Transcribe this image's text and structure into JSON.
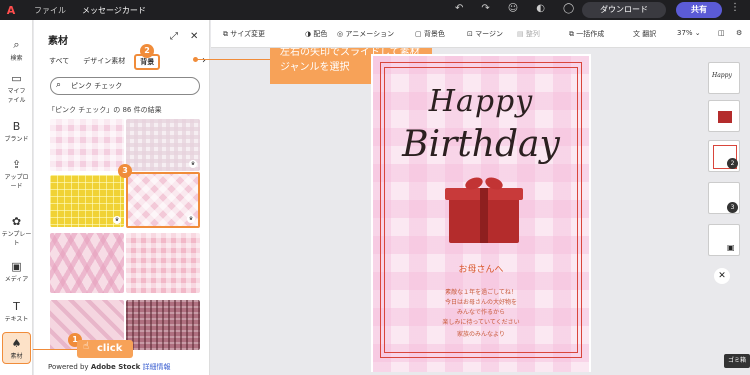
{
  "topbar": {
    "file_menu": "ファイル",
    "doc_title": "メッセージカード",
    "download": "ダウンロード",
    "share": "共有"
  },
  "leftnav": {
    "items": [
      {
        "label": "検索",
        "icon": "search-icon"
      },
      {
        "label": "マイファイル",
        "icon": "folder-icon"
      },
      {
        "label": "ブランド",
        "icon": "brand-icon"
      },
      {
        "label": "アップロード",
        "icon": "upload-icon"
      },
      {
        "label": "テンプレート",
        "icon": "template-icon"
      },
      {
        "label": "メディア",
        "icon": "media-icon"
      },
      {
        "label": "テキスト",
        "icon": "text-icon"
      },
      {
        "label": "素材",
        "icon": "assets-icon"
      }
    ]
  },
  "panel": {
    "title": "素材",
    "tabs": [
      "すべて",
      "デザイン素材",
      "背景"
    ],
    "active_tab": "背景",
    "search_value": "ピンク チェック",
    "results": "「ピンク チェック」の 86 件の結果",
    "footer_prefix": "Powered by",
    "footer_brand": "Adobe Stock",
    "footer_link": "詳細情報"
  },
  "annotations": {
    "step1": "1",
    "step2": "2",
    "step3": "3",
    "callout": "左右の矢印でスライドして素材ジャンルを選択",
    "click": "click"
  },
  "toolbar": {
    "resize": "サイズ変更",
    "color": "配色",
    "animation": "アニメーション",
    "bg_color": "背景色",
    "margin": "マージン",
    "arrange": "整列",
    "bulk_create": "一括作成",
    "translate": "翻訳",
    "zoom": "37%"
  },
  "card": {
    "line1": "Happy",
    "line2": "Birthday",
    "greeting": "お母さんへ",
    "messages": [
      "素敵な１年を過ごしてね！",
      "今日はお母さんの大好物を",
      "みんなで作るから",
      "楽しみに待っていてください",
      "家族のみんなより"
    ],
    "colors": {
      "frame": "#d9453b",
      "text": "#c85a3a",
      "accent": "#f08c3a"
    }
  },
  "pages": {
    "badges": [
      "2",
      "3"
    ]
  },
  "tooltip": "ゴミ箱"
}
